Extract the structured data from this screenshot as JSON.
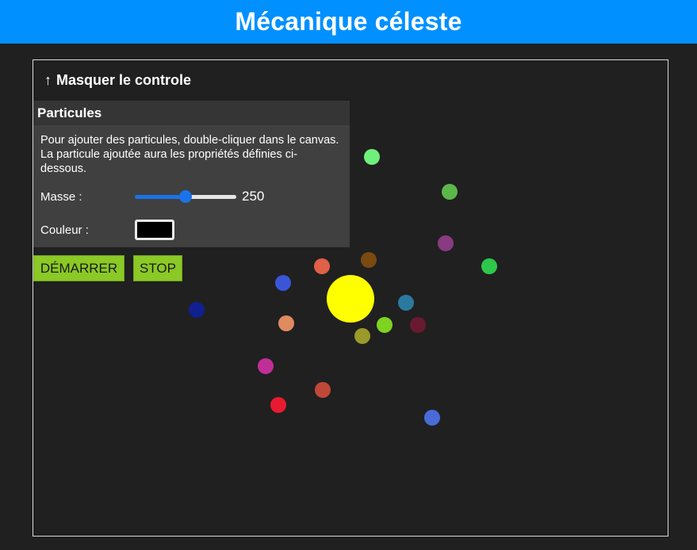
{
  "header": {
    "title": "Mécanique céleste"
  },
  "controls": {
    "toggle_label": "Masquer le controle",
    "toggle_icon": "arrow-up-icon",
    "panel_title": "Particules",
    "description": "Pour ajouter des particules, double-cliquer dans le canvas. La particule ajoutée aura les propriétés définies ci-dessous.",
    "mass_label": "Masse :",
    "mass_value": "250",
    "mass_fraction": 0.5,
    "color_label": "Couleur :",
    "color_value": "#000000",
    "start_label": "DÉMARRER",
    "stop_label": "STOP"
  },
  "colors": {
    "header_bg": "#0090ff",
    "canvas_bg": "#202020",
    "button_bg": "#8ac926",
    "slider_accent": "#1a73e8",
    "sun": "#ffff00"
  }
}
